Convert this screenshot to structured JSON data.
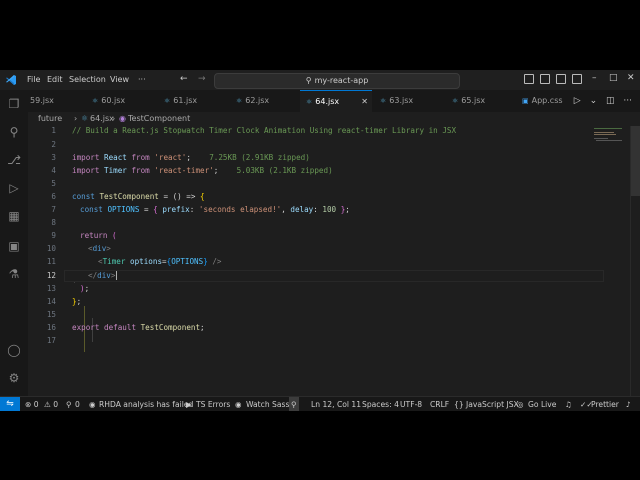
{
  "titlebar": {
    "menu": [
      "File",
      "Edit",
      "Selection",
      "View",
      "···"
    ],
    "back_icon": "arrow-left-icon",
    "forward_icon": "arrow-right-icon",
    "search_text": "my-react-app"
  },
  "tabs": [
    {
      "label": "59.jsx",
      "active": false
    },
    {
      "label": "60.jsx",
      "active": false
    },
    {
      "label": "61.jsx",
      "active": false
    },
    {
      "label": "62.jsx",
      "active": false
    },
    {
      "label": "64.jsx",
      "active": true,
      "close": "✕"
    },
    {
      "label": "63.jsx",
      "active": false
    },
    {
      "label": "65.jsx",
      "active": false
    },
    {
      "label": "App.css",
      "active": false
    }
  ],
  "breadcrumb": {
    "folder": "future",
    "sep": "›",
    "file": "64.jsx",
    "symbol": "TestComponent"
  },
  "editor": {
    "line_numbers": [
      "1",
      "2",
      "3",
      "4",
      "5",
      "6",
      "7",
      "8",
      "9",
      "10",
      "11",
      "12",
      "13",
      "14",
      "15",
      "16",
      "17"
    ],
    "current_line": 12,
    "cursor": "Ln 12, Col 11",
    "lines": {
      "l1": "// Build a React.js Stopwatch Timer Clock Animation Using react-timer Library in JSX",
      "l3_import": "import",
      "l3_name": "React",
      "l3_from": "from",
      "l3_str": "'react'",
      "l3_semi": ";",
      "l3_size": "7.25KB (2.91KB zipped)",
      "l4_import": "import",
      "l4_name": "Timer",
      "l4_from": "from",
      "l4_str": "'react-timer'",
      "l4_semi": ";",
      "l4_size": "5.03KB (2.1KB zipped)",
      "l6_const": "const",
      "l6_name": "TestComponent",
      "l6_rest": " = () => ",
      "l6_brace": "{",
      "l7_const": "const",
      "l7_name": "OPTIONS",
      "l7_eq": " = ",
      "l7_ob": "{",
      "l7_k1": "prefix",
      "l7_v1": "'seconds elapsed!'",
      "l7_k2": "delay",
      "l7_v2": "100",
      "l7_cb": "}",
      "l7_semi": ";",
      "l9_return": "return",
      "l9_paren": "(",
      "l10_open": "<",
      "l10_tag": "div",
      "l10_close": ">",
      "l11_open": "<",
      "l11_tag": "Timer",
      "l11_attr": "options",
      "l11_eq": "=",
      "l11_ob": "{",
      "l11_val": "OPTIONS",
      "l11_cb": "}",
      "l11_end": " />",
      "l12_open": "</",
      "l12_tag": "div",
      "l12_close": ">",
      "l13_paren": ")",
      "l13_semi": ";",
      "l14_brace": "}",
      "l14_semi": ";",
      "l16_export": "export",
      "l16_default": "default",
      "l16_name": "TestComponent",
      "l16_semi": ";"
    }
  },
  "status": {
    "errors": "⊗ 0",
    "warnings": "⚠ 0",
    "ports": "0",
    "rhda": "RHDA analysis has failed",
    "ts_errors": "TS Errors",
    "watch_sass": "Watch Sass",
    "position": "Ln 12, Col 11",
    "spaces": "Spaces: 4",
    "encoding": "UTF-8",
    "eol": "CRLF",
    "language": "JavaScript JSX",
    "golive": "Go Live",
    "prettier": "Prettier"
  },
  "colors": {
    "accent": "#0078d4",
    "editor_bg": "#1e1e1e",
    "chrome_bg": "#181818"
  }
}
